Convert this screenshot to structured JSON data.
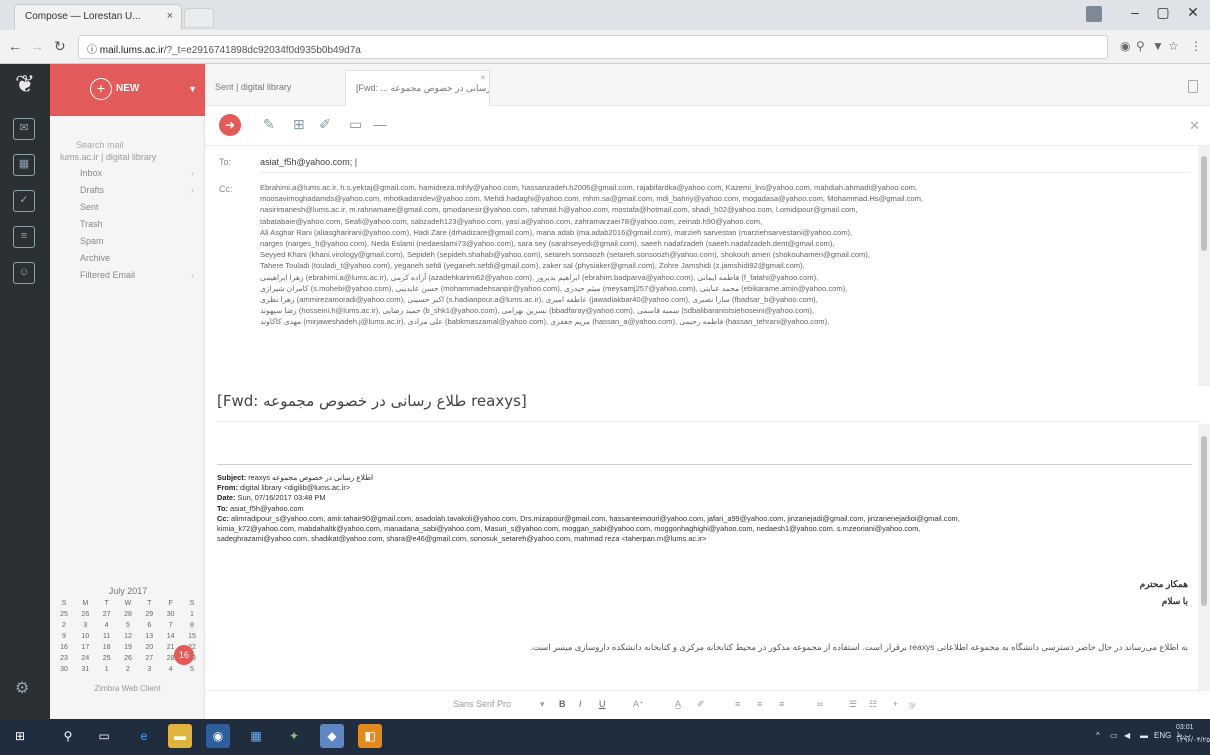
{
  "browser": {
    "tab_title": "Compose — Lorestan U...",
    "tab_close": "×",
    "url_prefix": "ⓘ mail.lums.ac.ir",
    "url_path": "/?_t=e2916741898dc92034f0d935b0b49d7a",
    "win_minimize": "–",
    "win_maximize": "▢",
    "win_close": "✕"
  },
  "rail": {
    "icons": [
      "mail-icon",
      "calendar-icon",
      "tasks-icon",
      "notes-icon",
      "contacts-icon",
      "settings-icon"
    ]
  },
  "sidebar": {
    "new_label": "NEW",
    "search_placeholder": "Search mail",
    "account": "lums.ac.ir | digital library",
    "folders": [
      "Inbox",
      "Drafts",
      "Sent",
      "Trash",
      "Spam",
      "Archive",
      "Filtered Email"
    ],
    "calendar": {
      "title": "July 2017",
      "weekdays": [
        "S",
        "M",
        "T",
        "W",
        "T",
        "F",
        "S"
      ],
      "weeks": [
        [
          "25",
          "26",
          "27",
          "28",
          "29",
          "30",
          "1"
        ],
        [
          "2",
          "3",
          "4",
          "5",
          "6",
          "7",
          "8"
        ],
        [
          "9",
          "10",
          "11",
          "12",
          "13",
          "14",
          "15"
        ],
        [
          "16",
          "17",
          "18",
          "19",
          "20",
          "21",
          "22"
        ],
        [
          "23",
          "24",
          "25",
          "26",
          "27",
          "28",
          "29"
        ],
        [
          "30",
          "31",
          "1",
          "2",
          "3",
          "4",
          "5"
        ]
      ],
      "today": "16"
    },
    "footer": "Zimbra Web Client"
  },
  "tabs": [
    {
      "label": "Sent | digital library"
    },
    {
      "label": "[Fwd: ... اطلاع رسانی در خصوص مجموعه",
      "close": "×"
    }
  ],
  "compose": {
    "to_label": "To:",
    "to_value": "asiat_f5h@yahoo.com; |",
    "cc_label": "Cc:",
    "cc_lines": [
      "Ebrahimi.a@lums.ac.ir, h.s.yektaj@gmail.com, hamidreza.mhfy@yahoo.com, hassanzadeh.h2006@gmail.com, rajabifardka@yahoo.com, Kazemi_lns@yahoo.com, mahdiah.ahmadi@yahoo.com,",
      "moosavimoghadamds@yahoo.com, mhotkadanidev@yahoo.com, Mehdi.hadaghi@yahoo.com, mhm.sa@gmail.com, mdi_bahriy@yahoo.com, mogadasa@yahoo.com, Mohammad.Hs@gmail.com,",
      "nasirimanesh@lums.ac.ir, m.rahnamaee@gmail.com, qmodanesir@yahoo.com, rahmati.h@yahoo.com, mostafa@hotmail.com, shadi_h02@yahoo.com, l.omidipour@gmail.com,",
      "tabatabaie@yahoo.com, Seafi@yahoo.com, sabzadeh123@yahoo.com, yasi.a@yahoo.com, zahramarzaei78@yahoo.com, zeinab.h90@yahoo.com,",
      "Ali Asghar Rani (aliasgharirani@yahoo.com), Hadi Zare (drhadizare@gmail.com), mana adab (ma.adab2016@gmail.com), marzieh sarvestan (marziehsarvestani@yahoo.com),",
      "narges (narges_h@yahoo.com), Neda Eslami (nedaeslami73@yahoo.com), sara sey (sarahseyedi@gmail.com), saeeh nadafzadeh (saeeh.nadafzadeh.dent@gmail.com),",
      "Seyyed Khani (khani.virology@gmail.com), Sepideh (sepideh.shahab@yahoo.com), setareh sonsoozh (setareh.sonsoozh@yahoo.com), shokouh ameri (shokouhameri@gmail.com),",
      "Tahere Touladi (touladi_t@yahoo.com), yeganeh sefdi (yeganeh.sefdi@gmail.com), zaker sal (physiaker@gmail.com), Zohre Jamshidi (z.jamshidi92@gmail.com),",
      "زهرا ابراهیمی (ebrahimi.a@lums.ac.ir), آزاده کرمی (azadehkarimi62@yahoo.com), ابراهیم بدپرور (ebrahim.badparva@yahoo.com), فاطمه ایمانی (f_fatahi@yahoo.com),",
      "کامران شیرازی (s.mohebi@yahoo.com), حسن عابدینی (mohammadehsanpir@yahoo.com), میثم حیدری (meysamj257@yahoo.com), محمد عنایتی (ebikarame.amin@yahoo.com),",
      "زهرا نظری (ammirezamoradi@yahoo.com), اکبر حسینی (s.hadianpour.a@lums.ac.ir), عاطفه امیری (jawadiakbar40@yahoo.com), سارا نصیری (fbadsar_b@yahoo.com),",
      "رضا سپهوند (hosseini.h@lums.ac.ir), حمید رضایی (b_shk1@yahoo.com), نسرین بهرامی (bbadfaray@yahoo.com), سمیه قاسمی (sdbalibaranistsiehoseini@yahoo.com),",
      "مهدی کاکاوند (mirjaweshadeh.j@lums.ac.ir), علی مرادی (babkmaszamal@yahoo.com), مریم جعفری (hassan_a@yahoo.com), فاطمه رحیمی (hassan_tehrani@yahoo.com),"
    ]
  },
  "subject_line": "[Fwd: طلاع رسانی در خصوص مجموعه reaxys]",
  "forwarded": {
    "subject_label": "Subject:",
    "subject_value": "reaxys اطلاع رسانی در خصوص مجموعه",
    "from_label": "From:",
    "from_value": "digital library <digilib@lums.ac.ir>",
    "date_label": "Date:",
    "date_value": "Sun, 07/16/2017 03:48 PM",
    "to_label": "To:",
    "to_value": "asiat_f5h@yahoo.com",
    "cc_label": "Cc:",
    "cc_lines": [
      "alimradipour_s@yahoo.com, amir.tahair90@gmail.com, asadolah.tavakoli@yahoo.com, Drs.mizapour@gmail.com, hassanteimouri@yahoo.com, jafari_a99@yahoo.com, jinzanejadi@gmail.com, jinzanenejadioi@gmail.com,",
      "kimia_k72@yahoo.com, mabdahaltk@yahoo.com, manadana_sabi@yahoo.com, Masuri_s@yahoo.com, moggan_sabi@yahoo.com, moggonhaghighi@yahoo.com, nedaesh1@yahoo.com, s.mzeoriani@yahoo.com,",
      "sadeghrazami@yahoo.com, shadikat@yahoo.com, shara@e46@gmail.com, sonosuk_setareh@yahoo.com, mahmad reza <taherpan.m@lums.ac.ir>"
    ]
  },
  "message": {
    "greeting": "همکار محترم",
    "salaam": "با سلام",
    "body": "به اطلاع می‌رساند در حال حاضر دسترسی دانشگاه به مجموعه اطلاعاتی reaxys برقرار است. استفاده از مجموعه مذکور در محیط کتابخانه مرکزی و کتابخانه دانشکده داروسازی میسر است."
  },
  "format_bar": {
    "font": "Sans Serif Pro",
    "bold": "B",
    "italic": "I",
    "underline": "U"
  },
  "tray": {
    "lang": "ENG",
    "time": "03:01 ب.ظ",
    "date": "۱۳۹۶/۰۴/۲۵"
  },
  "colors": {
    "accent": "#e35a5a",
    "rail": "#2b3033",
    "taskbar": "#1f2d3f"
  }
}
